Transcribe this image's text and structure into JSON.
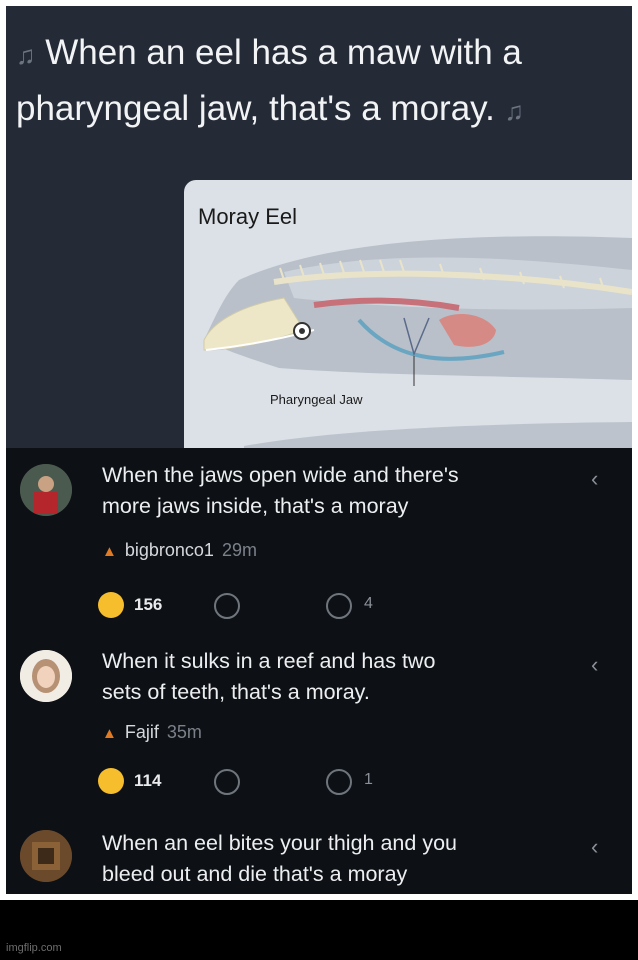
{
  "post": {
    "line1": "When an eel has a maw with a",
    "line2": "pharyngeal jaw, that's a moray.",
    "note_icon": "music-notes-icon"
  },
  "diagram": {
    "title": "Moray Eel",
    "label": "Pharyngeal Jaw"
  },
  "comments": [
    {
      "text_line1": "When the jaws open wide and there's",
      "text_line2": "more jaws inside, that's a moray",
      "user": "bigbronco1",
      "time": "29m",
      "likes": "156",
      "replies": "4"
    },
    {
      "text_line1": "When it sulks in a reef and has two",
      "text_line2": "sets of teeth, that's a moray.",
      "user": "Fajif",
      "time": "35m",
      "likes": "114",
      "replies": "1"
    },
    {
      "text_line1": "When an eel bites your thigh and you",
      "text_line2": "bleed out and die that's a moray"
    }
  ],
  "watermark": "imgflip.com",
  "colors": {
    "flame": "#e07a24",
    "smile": "#f6bd2d",
    "post_bg": "#242b37",
    "comments_bg": "#0d1015"
  }
}
